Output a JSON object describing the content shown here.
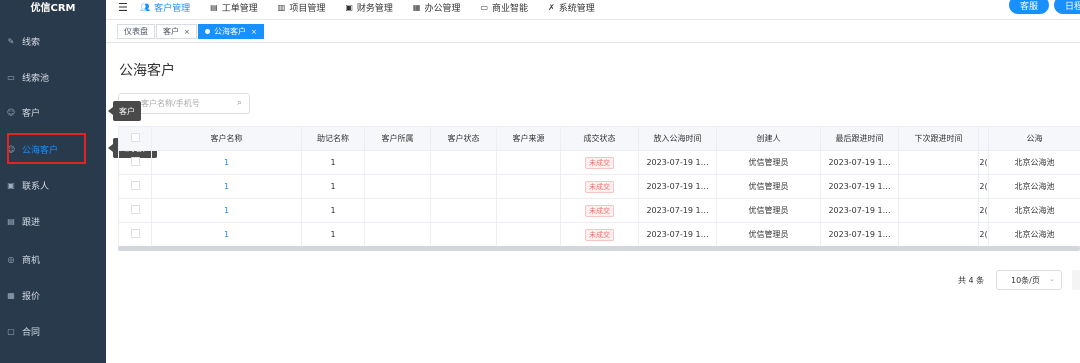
{
  "app": {
    "title": "优信CRM"
  },
  "sidebar": {
    "items": [
      {
        "label": "线索",
        "icon": "edit-icon"
      },
      {
        "label": "线索池",
        "icon": "inbox-icon"
      },
      {
        "label": "客户",
        "icon": "user-icon"
      },
      {
        "label": "公海客户",
        "icon": "user-icon"
      },
      {
        "label": "联系人",
        "icon": "contacts-icon"
      },
      {
        "label": "跟进",
        "icon": "followup-icon"
      },
      {
        "label": "商机",
        "icon": "opportunity-icon"
      },
      {
        "label": "报价",
        "icon": "quote-icon"
      },
      {
        "label": "合同",
        "icon": "contract-icon"
      }
    ],
    "active": "公海客户"
  },
  "topbar": {
    "menu": [
      {
        "label": "客户管理",
        "icon": "people-icon"
      },
      {
        "label": "工单管理",
        "icon": "ticket-icon"
      },
      {
        "label": "项目管理",
        "icon": "project-icon"
      },
      {
        "label": "财务管理",
        "icon": "finance-icon"
      },
      {
        "label": "办公管理",
        "icon": "office-icon"
      },
      {
        "label": "商业智能",
        "icon": "bi-icon"
      },
      {
        "label": "系统管理",
        "icon": "wrench-icon"
      }
    ],
    "service_label": "客服",
    "schedule_label": "日程",
    "accent": "#1890ff"
  },
  "tags": {
    "items": [
      "仪表盘",
      "客户",
      "公海客户"
    ],
    "active": "公海客户"
  },
  "tooltips": {
    "customer": "客户",
    "public_customer": "公海客户"
  },
  "page": {
    "title": "公海客户"
  },
  "search": {
    "placeholder": "客户名称/手机号"
  },
  "table": {
    "columns": [
      "",
      "客户名称",
      "助记名称",
      "客户所属",
      "客户状态",
      "客户来源",
      "成交状态",
      "放入公海时间",
      "创建人",
      "最后跟进时间",
      "下次跟进时间",
      "",
      "公海"
    ],
    "rows": [
      {
        "name": "1",
        "alias": "1",
        "owner": "",
        "state": "",
        "source": "",
        "deal": "未成交",
        "put_time": "2023-07-19 1…",
        "creator": "优信管理员",
        "last_follow": "2023-07-19 1…",
        "next_follow": "",
        "extra": "2(",
        "pool": "北京公海池"
      },
      {
        "name": "1",
        "alias": "1",
        "owner": "",
        "state": "",
        "source": "",
        "deal": "未成交",
        "put_time": "2023-07-19 1…",
        "creator": "优信管理员",
        "last_follow": "2023-07-19 1…",
        "next_follow": "",
        "extra": "2(",
        "pool": "北京公海池"
      },
      {
        "name": "1",
        "alias": "1",
        "owner": "",
        "state": "",
        "source": "",
        "deal": "未成交",
        "put_time": "2023-07-19 1…",
        "creator": "优信管理员",
        "last_follow": "2023-07-19 1…",
        "next_follow": "",
        "extra": "2(",
        "pool": "北京公海池"
      },
      {
        "name": "1",
        "alias": "1",
        "owner": "",
        "state": "",
        "source": "",
        "deal": "未成交",
        "put_time": "2023-07-19 1…",
        "creator": "优信管理员",
        "last_follow": "2023-07-19 1…",
        "next_follow": "",
        "extra": "2(",
        "pool": "北京公海池"
      }
    ]
  },
  "pagination": {
    "total_label": "共 4 条",
    "page_size": "10条/页"
  }
}
